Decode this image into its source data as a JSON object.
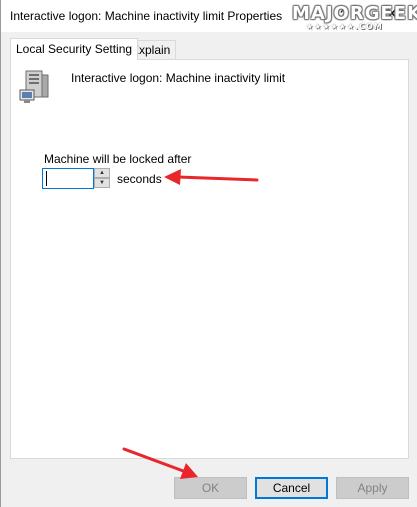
{
  "window": {
    "title": "Interactive logon: Machine inactivity limit Properties",
    "help_glyph": "?",
    "close_glyph": "✕"
  },
  "watermark": {
    "text": "MAJORGEEKS",
    "sub": "★★★★★★.COM"
  },
  "tabs": [
    {
      "label": "Local Security Setting",
      "active": true
    },
    {
      "label": "Explain",
      "active": false
    }
  ],
  "panel": {
    "icon": "server-computer-icon",
    "policy_name": "Interactive logon: Machine inactivity limit",
    "field_label": "Machine will be locked after",
    "field_value": "",
    "unit": "seconds"
  },
  "buttons": {
    "ok": "OK",
    "cancel": "Cancel",
    "apply": "Apply"
  },
  "colors": {
    "accent": "#0078d7",
    "annotation_arrow": "#e8262b"
  }
}
